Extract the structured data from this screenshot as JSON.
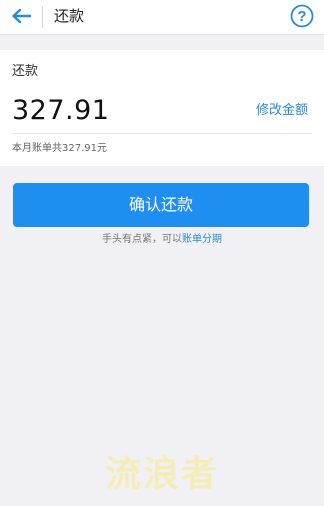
{
  "header": {
    "title": "还款",
    "back_icon": "arrow-left-icon",
    "help_icon": "question-circle-icon",
    "help_glyph": "?"
  },
  "repayment": {
    "label": "还款",
    "amount": "327.91",
    "modify_label": "修改金额",
    "bill_summary": "本月账单共327.91元"
  },
  "actions": {
    "confirm_label": "确认还款",
    "hint_prefix": "手头有点紧，可以",
    "installment_label": "账单分期"
  },
  "watermark": {
    "text": "流浪者"
  },
  "colors": {
    "accent": "#1e8ff0",
    "link": "#2a8ad8",
    "background": "#f1f1f5"
  }
}
